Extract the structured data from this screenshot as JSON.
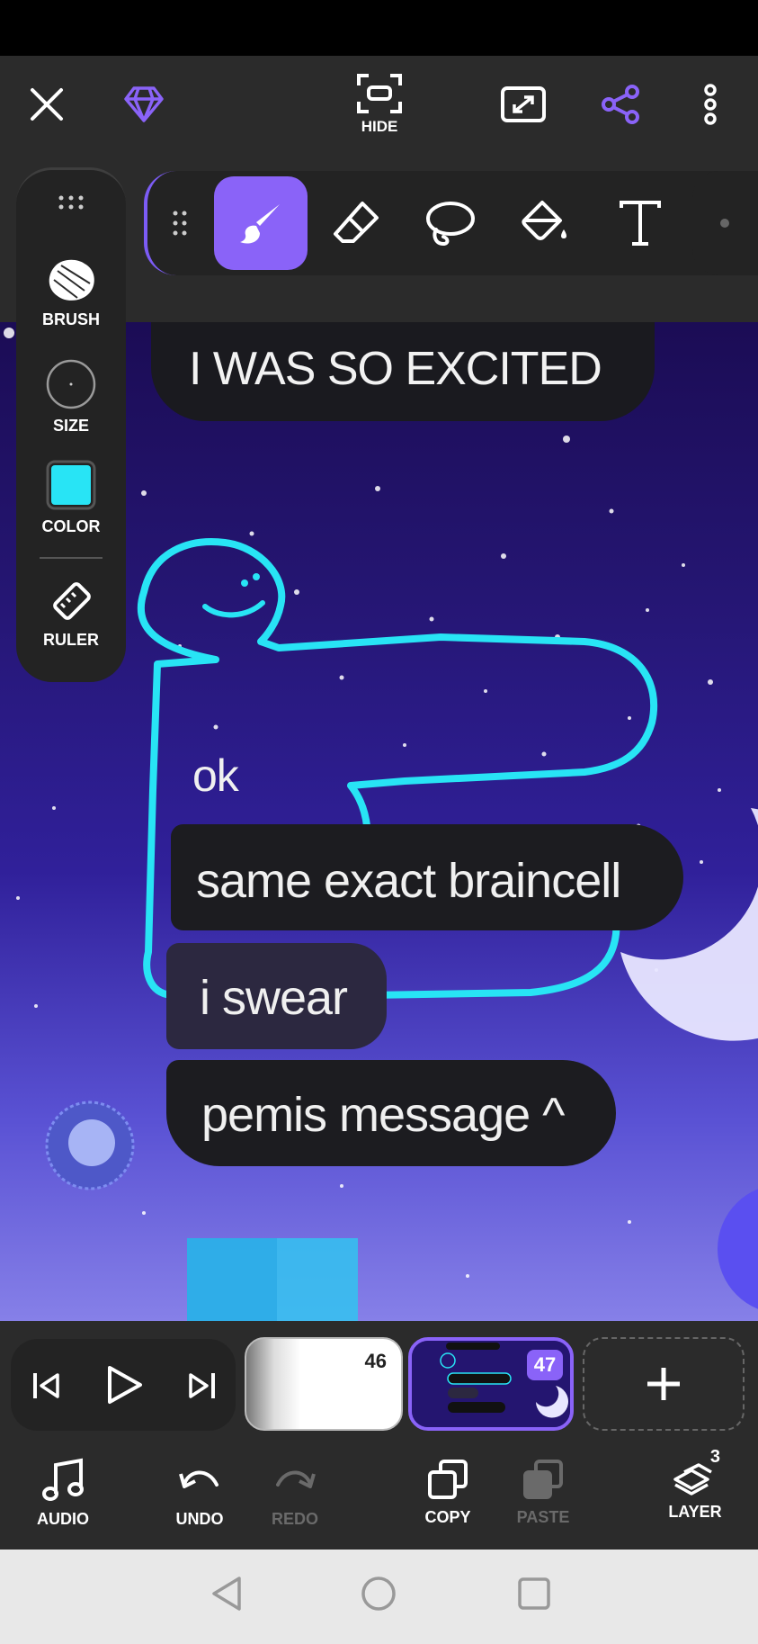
{
  "top_bar": {
    "close_icon": "close-icon",
    "premium_icon": "diamond-icon",
    "hide_label": "HIDE",
    "fullscreen_icon": "expand-icon",
    "share_icon": "share-icon",
    "more_icon": "more-vertical-icon",
    "accent_color": "#8a63f8"
  },
  "toolbar": {
    "tools": [
      "brush-icon",
      "eraser-icon",
      "lasso-icon",
      "fill-bucket-icon",
      "text-icon"
    ],
    "active_tool": "brush"
  },
  "side_panel": {
    "brush_label": "BRUSH",
    "size_label": "SIZE",
    "color_label": "COLOR",
    "ruler_label": "RULER",
    "current_color": "#28e4f5"
  },
  "artwork": {
    "top_message": "I WAS SO EXCITED",
    "reply_text": "ok",
    "messages": [
      "same exact braincell",
      "i swear",
      "pemis message ^"
    ],
    "outline_color": "#28e4f5"
  },
  "timeline": {
    "frames": [
      {
        "number": "46"
      },
      {
        "number": "47",
        "selected": true
      }
    ]
  },
  "bottom_bar": {
    "audio_label": "AUDIO",
    "undo_label": "UNDO",
    "redo_label": "REDO",
    "copy_label": "COPY",
    "paste_label": "PASTE",
    "layer_label": "LAYER",
    "layer_count": "3"
  }
}
